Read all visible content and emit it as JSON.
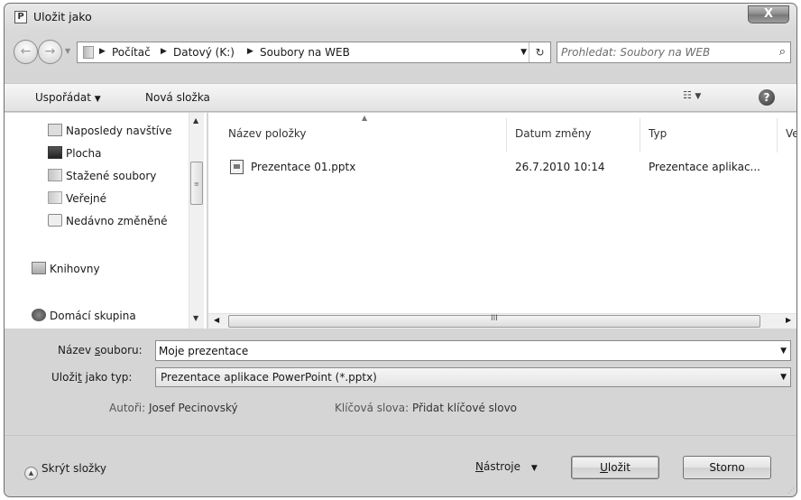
{
  "window": {
    "title": "Uložit jako",
    "app_icon": "P",
    "close_label": "X"
  },
  "address": {
    "crumbs": [
      "Počítač",
      "Datový (K:)",
      "Soubory na WEB"
    ]
  },
  "search": {
    "placeholder": "Prohledat: Soubory na WEB"
  },
  "toolbar": {
    "organize": "Uspořádat",
    "new_folder": "Nová složka",
    "help": "?"
  },
  "nav": {
    "items": [
      {
        "label": "Naposledy navštíve",
        "icon": "recent-places-icon"
      },
      {
        "label": "Plocha",
        "icon": "desktop-icon"
      },
      {
        "label": "Stažené soubory",
        "icon": "downloads-folder-icon"
      },
      {
        "label": "Veřejné",
        "icon": "public-folder-icon"
      },
      {
        "label": "Nedávno změněné",
        "icon": "recently-changed-icon"
      },
      {
        "label": "Knihovny",
        "icon": "libraries-icon"
      },
      {
        "label": "Domácí skupina",
        "icon": "homegroup-icon"
      }
    ]
  },
  "files": {
    "columns": [
      "Název položky",
      "Datum změny",
      "Typ",
      "Ve"
    ],
    "rows": [
      {
        "name": "Prezentace 01.pptx",
        "date": "26.7.2010 10:14",
        "type": "Prezentace aplikac..."
      }
    ],
    "hscroll_grip": "III"
  },
  "form": {
    "filename_label_pre": "Název ",
    "filename_label_key": "s",
    "filename_label_post": "ouboru:",
    "filename_value": "Moje prezentace",
    "type_label_pre": "Uloži",
    "type_label_key": "t",
    "type_label_post": " jako typ:",
    "type_value": "Prezentace aplikace PowerPoint (*.pptx)",
    "authors_label": "Autoři:",
    "authors_value": "Josef Pecinovský",
    "keywords_label": "Klíčová slova:",
    "keywords_value": "Přidat klíčové slovo"
  },
  "footer": {
    "hide_folders": "Skrýt složky",
    "tools_key": "N",
    "tools_rest": "ástroje",
    "save_key": "U",
    "save_rest": "ložit",
    "cancel": "Storno"
  }
}
